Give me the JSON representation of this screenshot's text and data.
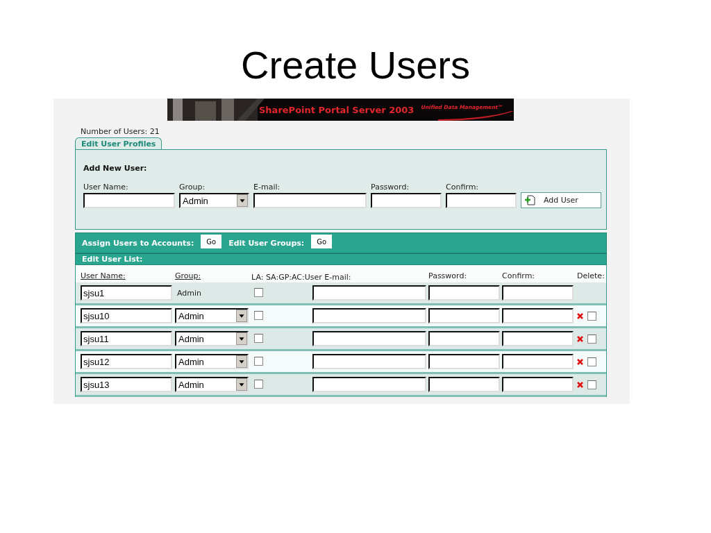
{
  "slide_title": "Create Users",
  "banner": {
    "title": "SharePoint Portal Server 2003",
    "tagline": "Unified Data Management™"
  },
  "user_count": "Number of Users: 21",
  "tabs": [
    {
      "label": "Edit User Profiles",
      "selected": true
    }
  ],
  "add_user": {
    "heading": "Add New User:",
    "labels": [
      "User Name:",
      "Group:",
      "E-mail:",
      "Password:",
      "Confirm:"
    ],
    "group_value": "Admin",
    "button": "Add User"
  },
  "actions": [
    {
      "label": "Assign Users to Accounts:",
      "button": "Go"
    },
    {
      "label": "Edit User Groups:",
      "button": "Go"
    }
  ],
  "list_title": "Edit User List:",
  "columns": [
    "User Name:",
    "Group:",
    "LA: SA:GP:AC:User E-mail:",
    "Password:",
    "Confirm:",
    "Delete:"
  ],
  "rows": [
    {
      "kind": "static",
      "user_name": "sjsu1",
      "group": "Admin",
      "checked": false
    },
    {
      "kind": "editable",
      "user_name": "sjsu10",
      "group": "Admin",
      "checked": false,
      "delete_checked": false
    },
    {
      "kind": "editable",
      "user_name": "sjsu11",
      "group": "Admin",
      "checked": false,
      "delete_checked": false
    },
    {
      "kind": "editable",
      "user_name": "sjsu12",
      "group": "Admin",
      "checked": false,
      "delete_checked": false
    },
    {
      "kind": "editable",
      "user_name": "sjsu13",
      "group": "Admin",
      "checked": false,
      "delete_checked": false
    }
  ]
}
